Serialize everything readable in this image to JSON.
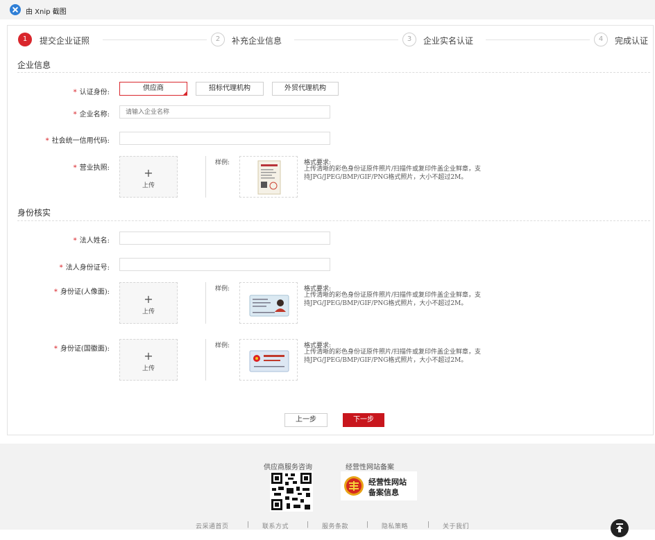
{
  "topbar": {
    "title": "由 Xnip 截图",
    "icon": "xnip-logo-icon"
  },
  "steps": [
    {
      "num": "1",
      "label": "提交企业证照",
      "active": true
    },
    {
      "num": "2",
      "label": "补充企业信息",
      "active": false
    },
    {
      "num": "3",
      "label": "企业实名认证",
      "active": false
    },
    {
      "num": "4",
      "label": "完成认证",
      "active": false
    }
  ],
  "company_section": {
    "title": "企业信息",
    "identity_label": "认证身份:",
    "identity_options": [
      "供应商",
      "招标代理机构",
      "外贸代理机构"
    ],
    "identity_selected": "供应商",
    "name_label": "企业名称:",
    "name_placeholder": "请输入企业名称",
    "credit_code_label": "社会统一信用代码:",
    "license_label": "营业执照:"
  },
  "identity_section": {
    "title": "身份核实",
    "legal_name_label": "法人姓名:",
    "legal_id_label": "法人身份证号:",
    "id_front_label": "身份证(人像面):",
    "id_back_label": "身份证(国徽面):"
  },
  "upload": {
    "label": "上传",
    "plus": "+"
  },
  "sample": {
    "label": "样例:"
  },
  "format": {
    "title": "格式要求:",
    "line1": "上传清晰的彩色身份证原件照片/扫描件或复印件盖企业鲜章，支",
    "line2": "持JPG/JPEG/BMP/GIF/PNG格式照片，大小不超过2M。"
  },
  "buttons": {
    "prev": "上一步",
    "next": "下一步"
  },
  "footer": {
    "service_title": "供应商服务咨询",
    "record_title": "经营性网站备案",
    "badge_line1": "经营性网站",
    "badge_line2": "备案信息",
    "links": [
      "云采通首页",
      "联系方式",
      "服务条款",
      "隐私策略",
      "关于我们"
    ],
    "separator": "|"
  },
  "colors": {
    "accent": "#d9262c",
    "next_button": "#c8161d",
    "footer_bg": "#f2f2f2"
  }
}
